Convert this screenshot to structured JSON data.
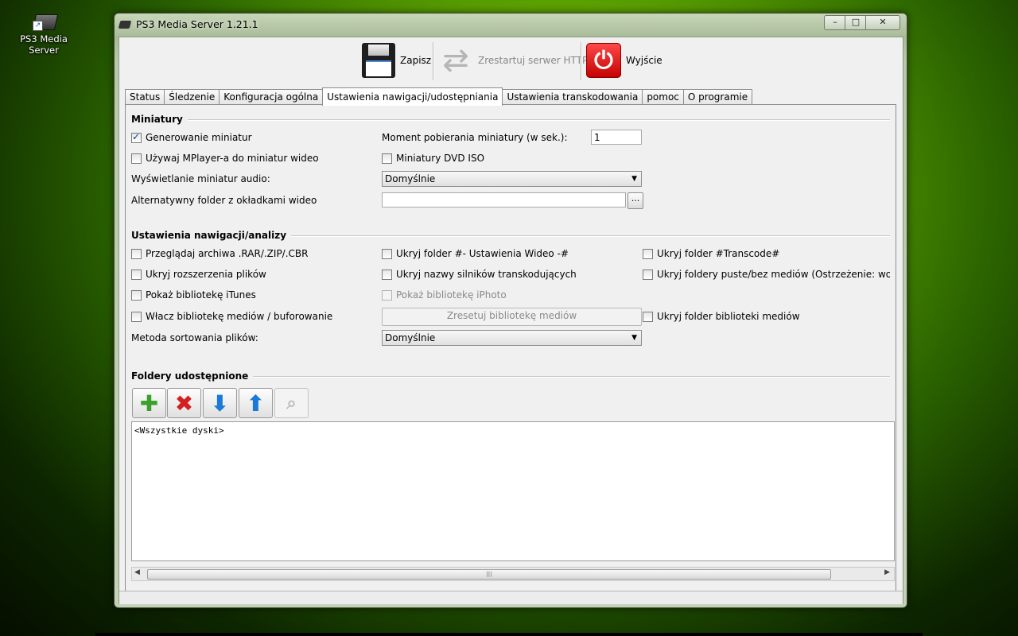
{
  "desktop": {
    "icon_label": "PS3 Media Server"
  },
  "window": {
    "title": "PS3 Media Server 1.21.1",
    "controls": {
      "minimize": "–",
      "maximize": "□",
      "close": "✕"
    }
  },
  "toolbar": {
    "save": "Zapisz",
    "restart": "Zrestartuj serwer HTTP",
    "exit": "Wyjście"
  },
  "tabs": [
    {
      "label": "Status"
    },
    {
      "label": "Śledzenie"
    },
    {
      "label": "Konfiguracja ogólna"
    },
    {
      "label": "Ustawienia nawigacji/udostępniania",
      "active": true
    },
    {
      "label": "Ustawienia transkodowania"
    },
    {
      "label": "pomoc"
    },
    {
      "label": "O programie"
    }
  ],
  "thumbnails": {
    "title": "Miniatury",
    "generate": {
      "label": "Generowanie miniatur",
      "checked": true
    },
    "seek_label": "Moment pobierania miniatury (w sek.):",
    "seek_value": "1",
    "mplayer": {
      "label": "Używaj MPlayer-a do miniatur wideo",
      "checked": false
    },
    "dvd_iso": {
      "label": "Miniatury DVD ISO",
      "checked": false
    },
    "audio_label": "Wyświetlanie miniatur audio:",
    "audio_value": "Domyślnie",
    "cover_folder_label": "Alternatywny folder z okładkami wideo",
    "cover_folder_value": "",
    "browse_label": "..."
  },
  "navigation": {
    "title": "Ustawienia nawigacji/analizy",
    "browse_archives": "Przeglądaj archiwa .RAR/.ZIP/.CBR",
    "hide_video_settings": "Ukryj folder #- Ustawienia Wideo -#",
    "hide_transcode": "Ukryj folder #Transcode#",
    "hide_extensions": "Ukryj rozszerzenia plików",
    "hide_engine_names": "Ukryj nazwy silników transkodujących",
    "hide_empty": "Ukryj foldery puste/bez mediów (Ostrzeżenie: wolniejsze",
    "show_itunes": "Pokaż bibliotekę iTunes",
    "show_iphoto": "Pokaż bibliotekę iPhoto",
    "enable_cache": "Włacz bibliotekę mediów / buforowanie",
    "reset_cache": "Zresetuj bibliotekę mediów",
    "hide_media_library": "Ukryj folder biblioteki mediów",
    "sort_label": "Metoda sortowania plików:",
    "sort_value": "Domyślnie"
  },
  "shared": {
    "title": "Foldery udostępnione",
    "items": [
      "<Wszystkie dyski>"
    ],
    "scroll_grip": "|||"
  },
  "icons": {
    "add": "plus-folder-icon",
    "remove": "red-x-icon",
    "down": "arrow-down-icon",
    "up": "arrow-up-icon",
    "search": "magnifier-icon"
  },
  "colors": {
    "accent_blue": "#1a7ad6",
    "delete_red": "#d42020",
    "add_green": "#3aa02a",
    "power_red": "#e01010"
  }
}
